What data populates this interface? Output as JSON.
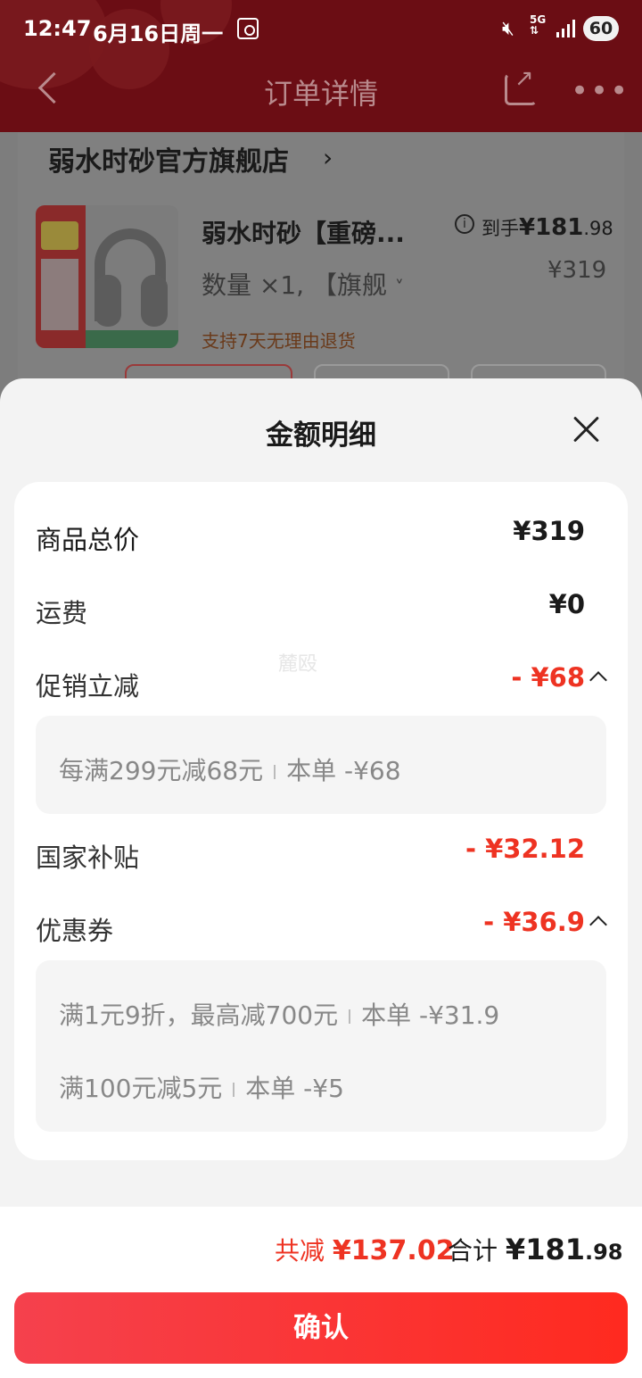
{
  "status_bar": {
    "time": "12:47",
    "date": "6月16日周一",
    "network": "5G",
    "battery": "60"
  },
  "nav": {
    "title": "订单详情"
  },
  "order": {
    "shop_name": "弱水时砂官方旗舰店",
    "product_title": "弱水时砂【重磅...",
    "final_price_label": "到手",
    "final_price_main": "¥181",
    "final_price_decimal": ".98",
    "spec": "数量 ×1, 【旗舰",
    "spec_chevron": "˅",
    "original_price": "¥319",
    "return_policy": "支持7天无理由退货"
  },
  "sheet": {
    "title": "金额明细",
    "watermark": "麓殴",
    "rows": [
      {
        "label": "商品总价",
        "value": "¥319"
      },
      {
        "label": "运费",
        "value": "¥0"
      },
      {
        "label": "促销立减",
        "value": "- ¥68"
      },
      {
        "label": "国家补贴",
        "value": "- ¥32.12"
      },
      {
        "label": "优惠券",
        "value": "- ¥36.9"
      }
    ],
    "promo_details": [
      {
        "rule": "每满299元减68元",
        "amount": "本单 -¥68"
      }
    ],
    "coupon_details": [
      {
        "rule": "满1元9折，最高减700元",
        "amount": "本单 -¥31.9"
      },
      {
        "rule": "满100元减5元",
        "amount": "本单 -¥5"
      }
    ]
  },
  "footer": {
    "discount_label": "共减",
    "discount_value": "¥137.02",
    "total_label": "合计",
    "total_currency": "¥",
    "total_main": "181",
    "total_decimal": ".98",
    "confirm_label": "确认"
  },
  "colors": {
    "accent_red": "#ee3322",
    "header_bg": "#6b0d14",
    "confirm_gradient_start": "#f5414d",
    "confirm_gradient_end": "#ff2a1f"
  }
}
